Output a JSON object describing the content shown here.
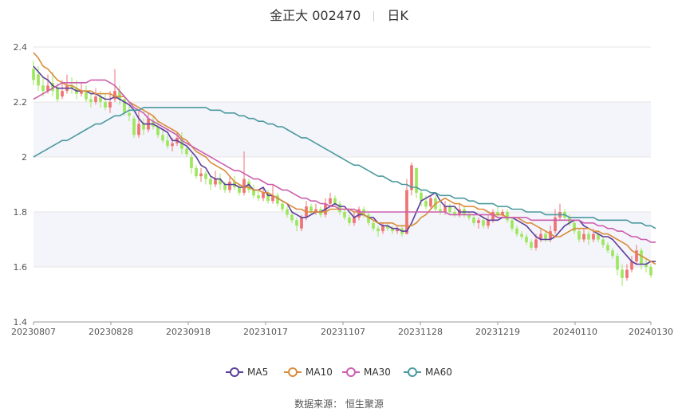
{
  "header": {
    "stock": "金正大 002470",
    "period": "日K"
  },
  "source_text": "数据来源： 恒生聚源",
  "colors": {
    "up": "#ef7373",
    "down": "#9de75e",
    "MA5": "#5b3f9a",
    "MA10": "#d98c3a",
    "MA30": "#cc5fae",
    "MA60": "#4a9a9e",
    "band": "#f4f4fb",
    "grid": "#e6e6e6"
  },
  "chart_data": {
    "type": "candlestick",
    "title": "金正大 002470 日K",
    "ylim": [
      1.4,
      2.4
    ],
    "yticks": [
      "2.4",
      "2.2",
      "2",
      "1.8",
      "1.6",
      "1.4"
    ],
    "xticks": [
      "20230807",
      "20230828",
      "20230918",
      "20231017",
      "20231107",
      "20231128",
      "20231219",
      "20240110",
      "20240130"
    ],
    "legend": [
      "MA5",
      "MA10",
      "MA30",
      "MA60"
    ],
    "legend_position": "bottom",
    "candles": [
      [
        2.32,
        2.28,
        2.35,
        2.26
      ],
      [
        2.3,
        2.26,
        2.33,
        2.24
      ],
      [
        2.26,
        2.24,
        2.29,
        2.22
      ],
      [
        2.24,
        2.26,
        2.3,
        2.23
      ],
      [
        2.27,
        2.24,
        2.31,
        2.22
      ],
      [
        2.25,
        2.21,
        2.27,
        2.2
      ],
      [
        2.22,
        2.24,
        2.28,
        2.21
      ],
      [
        2.24,
        2.26,
        2.3,
        2.23
      ],
      [
        2.26,
        2.25,
        2.29,
        2.23
      ],
      [
        2.25,
        2.23,
        2.28,
        2.21
      ],
      [
        2.23,
        2.24,
        2.27,
        2.22
      ],
      [
        2.24,
        2.21,
        2.26,
        2.2
      ],
      [
        2.21,
        2.2,
        2.23,
        2.18
      ],
      [
        2.2,
        2.22,
        2.25,
        2.19
      ],
      [
        2.22,
        2.2,
        2.24,
        2.18
      ],
      [
        2.2,
        2.18,
        2.23,
        2.17
      ],
      [
        2.18,
        2.2,
        2.24,
        2.16
      ],
      [
        2.21,
        2.24,
        2.32,
        2.2
      ],
      [
        2.24,
        2.21,
        2.26,
        2.19
      ],
      [
        2.21,
        2.16,
        2.22,
        2.15
      ],
      [
        2.16,
        2.15,
        2.19,
        2.13
      ],
      [
        2.14,
        2.08,
        2.15,
        2.07
      ],
      [
        2.08,
        2.12,
        2.17,
        2.07
      ],
      [
        2.12,
        2.1,
        2.14,
        2.08
      ],
      [
        2.1,
        2.14,
        2.16,
        2.09
      ],
      [
        2.13,
        2.11,
        2.15,
        2.1
      ],
      [
        2.11,
        2.08,
        2.13,
        2.07
      ],
      [
        2.08,
        2.06,
        2.1,
        2.05
      ],
      [
        2.06,
        2.04,
        2.08,
        2.03
      ],
      [
        2.04,
        2.05,
        2.07,
        2.02
      ],
      [
        2.05,
        2.07,
        2.09,
        2.04
      ],
      [
        2.07,
        2.03,
        2.09,
        2.01
      ],
      [
        2.03,
        2.01,
        2.04,
        2.0
      ],
      [
        2.0,
        1.96,
        2.01,
        1.94
      ],
      [
        1.96,
        1.93,
        1.97,
        1.92
      ],
      [
        1.93,
        1.94,
        1.96,
        1.91
      ],
      [
        1.94,
        1.92,
        1.95,
        1.9
      ],
      [
        1.92,
        1.9,
        1.93,
        1.88
      ],
      [
        1.9,
        1.92,
        1.95,
        1.89
      ],
      [
        1.92,
        1.9,
        1.94,
        1.88
      ],
      [
        1.9,
        1.88,
        1.91,
        1.87
      ],
      [
        1.88,
        1.91,
        1.93,
        1.87
      ],
      [
        1.91,
        1.89,
        1.93,
        1.88
      ],
      [
        1.89,
        1.87,
        1.9,
        1.86
      ],
      [
        1.87,
        1.92,
        2.02,
        1.86
      ],
      [
        1.91,
        1.88,
        1.92,
        1.87
      ],
      [
        1.88,
        1.86,
        1.9,
        1.85
      ],
      [
        1.86,
        1.85,
        1.88,
        1.84
      ],
      [
        1.85,
        1.87,
        1.89,
        1.84
      ],
      [
        1.87,
        1.84,
        1.88,
        1.83
      ],
      [
        1.84,
        1.86,
        1.9,
        1.83
      ],
      [
        1.86,
        1.83,
        1.87,
        1.82
      ],
      [
        1.83,
        1.81,
        1.84,
        1.8
      ],
      [
        1.81,
        1.79,
        1.82,
        1.78
      ],
      [
        1.79,
        1.77,
        1.8,
        1.76
      ],
      [
        1.77,
        1.75,
        1.78,
        1.73
      ],
      [
        1.74,
        1.78,
        1.79,
        1.73
      ],
      [
        1.78,
        1.82,
        1.84,
        1.77
      ],
      [
        1.82,
        1.8,
        1.83,
        1.79
      ],
      [
        1.8,
        1.81,
        1.83,
        1.79
      ],
      [
        1.81,
        1.79,
        1.82,
        1.78
      ],
      [
        1.79,
        1.83,
        1.85,
        1.78
      ],
      [
        1.83,
        1.85,
        1.87,
        1.82
      ],
      [
        1.85,
        1.83,
        1.86,
        1.82
      ],
      [
        1.83,
        1.8,
        1.84,
        1.79
      ],
      [
        1.8,
        1.78,
        1.81,
        1.77
      ],
      [
        1.78,
        1.76,
        1.79,
        1.75
      ],
      [
        1.76,
        1.78,
        1.8,
        1.75
      ],
      [
        1.78,
        1.81,
        1.82,
        1.77
      ],
      [
        1.81,
        1.79,
        1.82,
        1.78
      ],
      [
        1.79,
        1.76,
        1.8,
        1.75
      ],
      [
        1.76,
        1.74,
        1.77,
        1.73
      ],
      [
        1.74,
        1.73,
        1.75,
        1.71
      ],
      [
        1.73,
        1.75,
        1.76,
        1.72
      ],
      [
        1.75,
        1.74,
        1.76,
        1.73
      ],
      [
        1.74,
        1.73,
        1.75,
        1.72
      ],
      [
        1.73,
        1.74,
        1.75,
        1.72
      ],
      [
        1.74,
        1.72,
        1.75,
        1.71
      ],
      [
        1.72,
        1.88,
        1.92,
        1.72
      ],
      [
        1.88,
        1.97,
        1.98,
        1.86
      ],
      [
        1.96,
        1.87,
        1.96,
        1.85
      ],
      [
        1.87,
        1.84,
        1.88,
        1.82
      ],
      [
        1.84,
        1.82,
        1.86,
        1.81
      ],
      [
        1.82,
        1.85,
        1.86,
        1.81
      ],
      [
        1.85,
        1.81,
        1.86,
        1.8
      ],
      [
        1.81,
        1.8,
        1.83,
        1.79
      ],
      [
        1.8,
        1.82,
        1.84,
        1.79
      ],
      [
        1.82,
        1.8,
        1.83,
        1.79
      ],
      [
        1.8,
        1.79,
        1.82,
        1.78
      ],
      [
        1.79,
        1.81,
        1.83,
        1.78
      ],
      [
        1.81,
        1.79,
        1.82,
        1.78
      ],
      [
        1.79,
        1.78,
        1.8,
        1.77
      ],
      [
        1.78,
        1.76,
        1.79,
        1.75
      ],
      [
        1.76,
        1.77,
        1.78,
        1.74
      ],
      [
        1.77,
        1.75,
        1.78,
        1.74
      ],
      [
        1.75,
        1.77,
        1.79,
        1.74
      ],
      [
        1.77,
        1.8,
        1.81,
        1.76
      ],
      [
        1.8,
        1.79,
        1.82,
        1.78
      ],
      [
        1.79,
        1.8,
        1.81,
        1.78
      ],
      [
        1.8,
        1.77,
        1.81,
        1.76
      ],
      [
        1.77,
        1.74,
        1.78,
        1.73
      ],
      [
        1.74,
        1.72,
        1.75,
        1.71
      ],
      [
        1.72,
        1.71,
        1.73,
        1.7
      ],
      [
        1.71,
        1.69,
        1.72,
        1.68
      ],
      [
        1.69,
        1.67,
        1.7,
        1.66
      ],
      [
        1.67,
        1.7,
        1.72,
        1.66
      ],
      [
        1.7,
        1.72,
        1.74,
        1.69
      ],
      [
        1.72,
        1.7,
        1.73,
        1.69
      ],
      [
        1.7,
        1.73,
        1.75,
        1.69
      ],
      [
        1.73,
        1.78,
        1.81,
        1.72
      ],
      [
        1.78,
        1.8,
        1.83,
        1.77
      ],
      [
        1.8,
        1.78,
        1.81,
        1.77
      ],
      [
        1.78,
        1.76,
        1.79,
        1.75
      ],
      [
        1.76,
        1.73,
        1.77,
        1.72
      ],
      [
        1.73,
        1.7,
        1.74,
        1.69
      ],
      [
        1.7,
        1.72,
        1.74,
        1.69
      ],
      [
        1.72,
        1.7,
        1.73,
        1.68
      ],
      [
        1.7,
        1.72,
        1.74,
        1.69
      ],
      [
        1.72,
        1.7,
        1.73,
        1.69
      ],
      [
        1.7,
        1.68,
        1.71,
        1.67
      ],
      [
        1.68,
        1.66,
        1.69,
        1.65
      ],
      [
        1.66,
        1.64,
        1.67,
        1.63
      ],
      [
        1.64,
        1.59,
        1.65,
        1.57
      ],
      [
        1.59,
        1.56,
        1.61,
        1.53
      ],
      [
        1.56,
        1.59,
        1.61,
        1.55
      ],
      [
        1.59,
        1.62,
        1.64,
        1.58
      ],
      [
        1.62,
        1.66,
        1.68,
        1.61
      ],
      [
        1.66,
        1.61,
        1.67,
        1.59
      ],
      [
        1.61,
        1.6,
        1.63,
        1.58
      ],
      [
        1.6,
        1.57,
        1.61,
        1.56
      ]
    ],
    "ma": {
      "MA5": [
        2.33,
        2.31,
        2.29,
        2.28,
        2.26,
        2.25,
        2.25,
        2.25,
        2.25,
        2.24,
        2.24,
        2.24,
        2.23,
        2.23,
        2.22,
        2.21,
        2.21,
        2.22,
        2.21,
        2.2,
        2.19,
        2.17,
        2.14,
        2.12,
        2.12,
        2.12,
        2.11,
        2.1,
        2.09,
        2.06,
        2.06,
        2.05,
        2.04,
        2.02,
        2.0,
        1.97,
        1.96,
        1.93,
        1.92,
        1.92,
        1.9,
        1.9,
        1.9,
        1.89,
        1.89,
        1.9,
        1.88,
        1.88,
        1.89,
        1.86,
        1.86,
        1.85,
        1.84,
        1.83,
        1.8,
        1.79,
        1.78,
        1.78,
        1.79,
        1.8,
        1.8,
        1.81,
        1.82,
        1.83,
        1.82,
        1.82,
        1.8,
        1.78,
        1.79,
        1.79,
        1.78,
        1.78,
        1.76,
        1.75,
        1.75,
        1.74,
        1.74,
        1.73,
        1.73,
        1.76,
        1.8,
        1.84,
        1.85,
        1.86,
        1.87,
        1.84,
        1.82,
        1.82,
        1.82,
        1.8,
        1.8,
        1.8,
        1.8,
        1.79,
        1.78,
        1.77,
        1.77,
        1.77,
        1.78,
        1.78,
        1.78,
        1.77,
        1.76,
        1.75,
        1.73,
        1.71,
        1.7,
        1.7,
        1.7,
        1.71,
        1.73,
        1.75,
        1.76,
        1.77,
        1.77,
        1.75,
        1.74,
        1.73,
        1.72,
        1.71,
        1.71,
        1.7,
        1.68,
        1.66,
        1.64,
        1.62,
        1.61,
        1.61,
        1.61,
        1.62,
        1.62
      ],
      "MA10": [
        2.38,
        2.36,
        2.33,
        2.32,
        2.3,
        2.28,
        2.27,
        2.26,
        2.26,
        2.25,
        2.24,
        2.24,
        2.24,
        2.23,
        2.23,
        2.23,
        2.23,
        2.22,
        2.22,
        2.22,
        2.2,
        2.19,
        2.18,
        2.17,
        2.16,
        2.15,
        2.13,
        2.12,
        2.11,
        2.1,
        2.09,
        2.07,
        2.06,
        2.04,
        2.02,
        2.01,
        2.0,
        1.98,
        1.97,
        1.96,
        1.95,
        1.93,
        1.91,
        1.9,
        1.89,
        1.89,
        1.88,
        1.88,
        1.87,
        1.87,
        1.86,
        1.85,
        1.84,
        1.83,
        1.82,
        1.81,
        1.81,
        1.8,
        1.8,
        1.8,
        1.8,
        1.8,
        1.81,
        1.81,
        1.81,
        1.81,
        1.81,
        1.8,
        1.8,
        1.79,
        1.78,
        1.77,
        1.76,
        1.76,
        1.76,
        1.76,
        1.75,
        1.75,
        1.75,
        1.75,
        1.76,
        1.78,
        1.79,
        1.81,
        1.83,
        1.84,
        1.85,
        1.84,
        1.83,
        1.83,
        1.82,
        1.82,
        1.82,
        1.81,
        1.81,
        1.8,
        1.79,
        1.79,
        1.79,
        1.78,
        1.78,
        1.78,
        1.77,
        1.76,
        1.76,
        1.75,
        1.74,
        1.73,
        1.72,
        1.71,
        1.71,
        1.72,
        1.73,
        1.74,
        1.74,
        1.74,
        1.74,
        1.73,
        1.73,
        1.72,
        1.72,
        1.71,
        1.7,
        1.69,
        1.68,
        1.66,
        1.65,
        1.64,
        1.63,
        1.62,
        1.61
      ],
      "MA30": [
        2.21,
        2.22,
        2.23,
        2.24,
        2.25,
        2.26,
        2.27,
        2.27,
        2.27,
        2.27,
        2.27,
        2.27,
        2.28,
        2.28,
        2.28,
        2.28,
        2.27,
        2.26,
        2.24,
        2.22,
        2.2,
        2.18,
        2.17,
        2.16,
        2.14,
        2.13,
        2.12,
        2.11,
        2.1,
        2.09,
        2.08,
        2.06,
        2.05,
        2.04,
        2.03,
        2.02,
        2.01,
        2.0,
        1.99,
        1.98,
        1.97,
        1.96,
        1.95,
        1.95,
        1.94,
        1.93,
        1.92,
        1.92,
        1.91,
        1.9,
        1.9,
        1.89,
        1.88,
        1.88,
        1.87,
        1.86,
        1.85,
        1.85,
        1.84,
        1.84,
        1.83,
        1.83,
        1.82,
        1.82,
        1.81,
        1.81,
        1.81,
        1.81,
        1.8,
        1.8,
        1.8,
        1.8,
        1.8,
        1.8,
        1.8,
        1.8,
        1.8,
        1.8,
        1.8,
        1.8,
        1.8,
        1.8,
        1.8,
        1.8,
        1.8,
        1.8,
        1.8,
        1.79,
        1.79,
        1.79,
        1.79,
        1.79,
        1.79,
        1.79,
        1.79,
        1.79,
        1.79,
        1.78,
        1.78,
        1.78,
        1.78,
        1.78,
        1.78,
        1.78,
        1.77,
        1.77,
        1.77,
        1.77,
        1.77,
        1.77,
        1.77,
        1.77,
        1.77,
        1.77,
        1.77,
        1.76,
        1.76,
        1.76,
        1.75,
        1.75,
        1.74,
        1.74,
        1.73,
        1.73,
        1.72,
        1.71,
        1.71,
        1.7,
        1.7,
        1.69,
        1.69
      ],
      "MA60": [
        2.0,
        2.01,
        2.02,
        2.03,
        2.04,
        2.05,
        2.06,
        2.06,
        2.07,
        2.08,
        2.09,
        2.1,
        2.11,
        2.12,
        2.12,
        2.13,
        2.14,
        2.15,
        2.15,
        2.16,
        2.17,
        2.17,
        2.17,
        2.18,
        2.18,
        2.18,
        2.18,
        2.18,
        2.18,
        2.18,
        2.18,
        2.18,
        2.18,
        2.18,
        2.18,
        2.18,
        2.18,
        2.17,
        2.17,
        2.17,
        2.16,
        2.16,
        2.16,
        2.15,
        2.15,
        2.14,
        2.14,
        2.13,
        2.13,
        2.12,
        2.12,
        2.11,
        2.11,
        2.1,
        2.09,
        2.08,
        2.07,
        2.07,
        2.06,
        2.05,
        2.04,
        2.03,
        2.02,
        2.01,
        2.0,
        1.99,
        1.98,
        1.97,
        1.97,
        1.96,
        1.95,
        1.94,
        1.93,
        1.93,
        1.92,
        1.91,
        1.91,
        1.9,
        1.9,
        1.89,
        1.89,
        1.88,
        1.88,
        1.87,
        1.87,
        1.86,
        1.86,
        1.86,
        1.85,
        1.85,
        1.85,
        1.84,
        1.84,
        1.83,
        1.83,
        1.83,
        1.83,
        1.82,
        1.82,
        1.82,
        1.81,
        1.81,
        1.81,
        1.8,
        1.8,
        1.8,
        1.8,
        1.79,
        1.79,
        1.79,
        1.79,
        1.79,
        1.78,
        1.78,
        1.78,
        1.78,
        1.78,
        1.78,
        1.77,
        1.77,
        1.77,
        1.77,
        1.77,
        1.77,
        1.77,
        1.76,
        1.76,
        1.76,
        1.75,
        1.75,
        1.74
      ]
    }
  }
}
